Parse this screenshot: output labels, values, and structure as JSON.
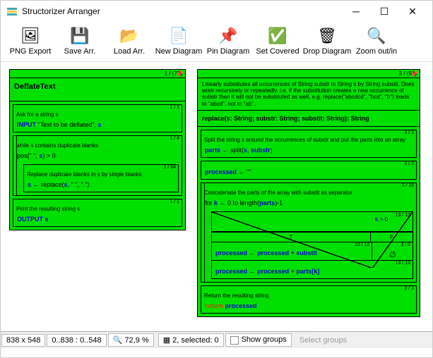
{
  "window": {
    "title": "Structorizer Arranger"
  },
  "toolbar": [
    {
      "id": "png-export",
      "label": "PNG Export",
      "icon": "🖼"
    },
    {
      "id": "save-arr",
      "label": "Save Arr.",
      "icon": "💾"
    },
    {
      "id": "load-arr",
      "label": "Load Arr.",
      "icon": "📂"
    },
    {
      "id": "new-diagram",
      "label": "New Diagram",
      "icon": "📄"
    },
    {
      "id": "pin-diagram",
      "label": "Pin Diagram",
      "icon": "📌"
    },
    {
      "id": "set-covered",
      "label": "Set Covered",
      "icon": "✅"
    },
    {
      "id": "drop-diagram",
      "label": "Drop Diagram",
      "icon": "🗑"
    },
    {
      "id": "zoom",
      "label": "Zoom out/in",
      "icon": "🔍"
    }
  ],
  "diagram1": {
    "counter": "1 / (70)",
    "title": "DeflateText",
    "b1": {
      "cnt": "1 / 1",
      "comment": "Ask for a string s",
      "content_prefix": "INPUT",
      "content_quote": "\"Text to be deflated\", ",
      "var": "s"
    },
    "b2": {
      "cnt": "1 / 4",
      "comment": "while s contains duplicate blanks",
      "cond_pre": "pos(\"  \", ",
      "cond_var": "s",
      "cond_post": ") > 0",
      "inner": {
        "cnt": "3 / 64",
        "comment": "Replace duplicate blanks in s by single blanks",
        "lhs": "s",
        "arrow": " ← replace(",
        "a1": "s",
        "rest": ", \"  \", \" \")"
      }
    },
    "b3": {
      "cnt": "1 / 1",
      "comment": "Print the resulting string s",
      "kw": "OUTPUT ",
      "var": "s"
    }
  },
  "diagram2": {
    "counter": "3 / (61)",
    "comment": "Linearly substitutes all occurrences of String substr in String s by String substit. Does work recursively or repeatedly, i.e. if the substitution creates a new occurrence of substr then it will not be substituted as well, e.g. replace(\"abcdcd\", \"bcd\", \"b\") leads to \"abcd\", not to \"ab\".",
    "sig": "replace(s: String; substr: String; substit: String): String",
    "b1": {
      "cnt": "3 / 3",
      "comment": "Split the string s around the occurrences of substr and put the parts into an array",
      "lhs": "parts",
      "arrow": " ← split(",
      "a1": "s",
      "mid": ", ",
      "a2": "substr",
      "post": ")"
    },
    "b2": {
      "cnt": "3 / 3",
      "lhs": "processed",
      "arrow": " ← \"\""
    },
    "b3": {
      "cnt": "3 / 16",
      "comment": "Concatenate the parts of the array with substit as separator",
      "for_pre": "for ",
      "for_var": "k",
      "for_mid": " ← 0 to length(",
      "for_arg": "parts",
      "for_post": ")-1"
    },
    "cond": {
      "cnt": "13 / 13",
      "text_pre": "",
      "var": "k",
      "text_post": " > 0",
      "T": "T",
      "F": "F"
    },
    "b4": {
      "cnt": "10 / 10",
      "lhs": "processed",
      "arrow": " ← ",
      "r1": "processed",
      "plus": " + ",
      "r2": "substit",
      "empty_cnt": "3 / 0",
      "empty": "∅"
    },
    "b5": {
      "cnt": "13 / 13",
      "lhs": "processed",
      "arrow": " ← ",
      "r1": "processed",
      "plus": " + ",
      "r2": "parts[k]"
    },
    "b6": {
      "cnt": "3 / 3",
      "comment": "Return the resulting string",
      "kw": "return ",
      "var": "processed"
    }
  },
  "status": {
    "dims": "838 x 548",
    "range": "0..838 : 0..548",
    "zoom": "72,9 %",
    "sel": "2, selected: 0",
    "showgroups": "Show groups",
    "selectgroups": "Select groups"
  }
}
